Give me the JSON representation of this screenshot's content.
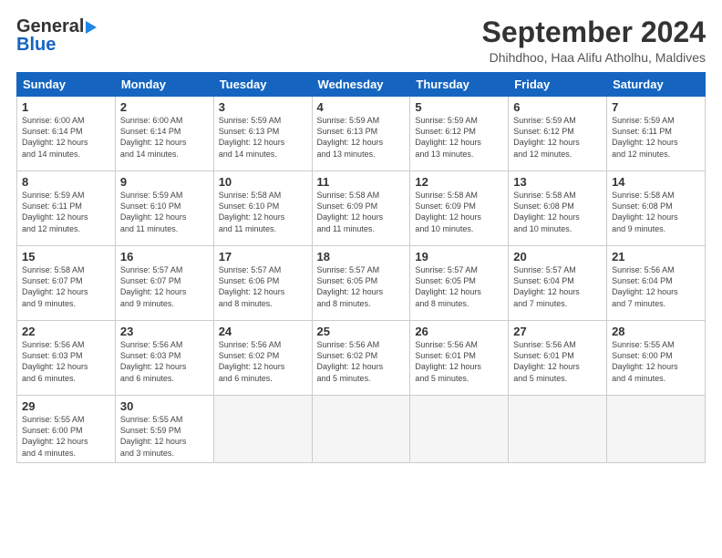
{
  "logo": {
    "general": "General",
    "blue": "Blue"
  },
  "header": {
    "month": "September 2024",
    "location": "Dhihdhoo, Haa Alifu Atholhu, Maldives"
  },
  "weekdays": [
    "Sunday",
    "Monday",
    "Tuesday",
    "Wednesday",
    "Thursday",
    "Friday",
    "Saturday"
  ],
  "weeks": [
    [
      {
        "day": "1",
        "info": "Sunrise: 6:00 AM\nSunset: 6:14 PM\nDaylight: 12 hours\nand 14 minutes."
      },
      {
        "day": "2",
        "info": "Sunrise: 6:00 AM\nSunset: 6:14 PM\nDaylight: 12 hours\nand 14 minutes."
      },
      {
        "day": "3",
        "info": "Sunrise: 5:59 AM\nSunset: 6:13 PM\nDaylight: 12 hours\nand 14 minutes."
      },
      {
        "day": "4",
        "info": "Sunrise: 5:59 AM\nSunset: 6:13 PM\nDaylight: 12 hours\nand 13 minutes."
      },
      {
        "day": "5",
        "info": "Sunrise: 5:59 AM\nSunset: 6:12 PM\nDaylight: 12 hours\nand 13 minutes."
      },
      {
        "day": "6",
        "info": "Sunrise: 5:59 AM\nSunset: 6:12 PM\nDaylight: 12 hours\nand 12 minutes."
      },
      {
        "day": "7",
        "info": "Sunrise: 5:59 AM\nSunset: 6:11 PM\nDaylight: 12 hours\nand 12 minutes."
      }
    ],
    [
      {
        "day": "8",
        "info": "Sunrise: 5:59 AM\nSunset: 6:11 PM\nDaylight: 12 hours\nand 12 minutes."
      },
      {
        "day": "9",
        "info": "Sunrise: 5:59 AM\nSunset: 6:10 PM\nDaylight: 12 hours\nand 11 minutes."
      },
      {
        "day": "10",
        "info": "Sunrise: 5:58 AM\nSunset: 6:10 PM\nDaylight: 12 hours\nand 11 minutes."
      },
      {
        "day": "11",
        "info": "Sunrise: 5:58 AM\nSunset: 6:09 PM\nDaylight: 12 hours\nand 11 minutes."
      },
      {
        "day": "12",
        "info": "Sunrise: 5:58 AM\nSunset: 6:09 PM\nDaylight: 12 hours\nand 10 minutes."
      },
      {
        "day": "13",
        "info": "Sunrise: 5:58 AM\nSunset: 6:08 PM\nDaylight: 12 hours\nand 10 minutes."
      },
      {
        "day": "14",
        "info": "Sunrise: 5:58 AM\nSunset: 6:08 PM\nDaylight: 12 hours\nand 9 minutes."
      }
    ],
    [
      {
        "day": "15",
        "info": "Sunrise: 5:58 AM\nSunset: 6:07 PM\nDaylight: 12 hours\nand 9 minutes."
      },
      {
        "day": "16",
        "info": "Sunrise: 5:57 AM\nSunset: 6:07 PM\nDaylight: 12 hours\nand 9 minutes."
      },
      {
        "day": "17",
        "info": "Sunrise: 5:57 AM\nSunset: 6:06 PM\nDaylight: 12 hours\nand 8 minutes."
      },
      {
        "day": "18",
        "info": "Sunrise: 5:57 AM\nSunset: 6:05 PM\nDaylight: 12 hours\nand 8 minutes."
      },
      {
        "day": "19",
        "info": "Sunrise: 5:57 AM\nSunset: 6:05 PM\nDaylight: 12 hours\nand 8 minutes."
      },
      {
        "day": "20",
        "info": "Sunrise: 5:57 AM\nSunset: 6:04 PM\nDaylight: 12 hours\nand 7 minutes."
      },
      {
        "day": "21",
        "info": "Sunrise: 5:56 AM\nSunset: 6:04 PM\nDaylight: 12 hours\nand 7 minutes."
      }
    ],
    [
      {
        "day": "22",
        "info": "Sunrise: 5:56 AM\nSunset: 6:03 PM\nDaylight: 12 hours\nand 6 minutes."
      },
      {
        "day": "23",
        "info": "Sunrise: 5:56 AM\nSunset: 6:03 PM\nDaylight: 12 hours\nand 6 minutes."
      },
      {
        "day": "24",
        "info": "Sunrise: 5:56 AM\nSunset: 6:02 PM\nDaylight: 12 hours\nand 6 minutes."
      },
      {
        "day": "25",
        "info": "Sunrise: 5:56 AM\nSunset: 6:02 PM\nDaylight: 12 hours\nand 5 minutes."
      },
      {
        "day": "26",
        "info": "Sunrise: 5:56 AM\nSunset: 6:01 PM\nDaylight: 12 hours\nand 5 minutes."
      },
      {
        "day": "27",
        "info": "Sunrise: 5:56 AM\nSunset: 6:01 PM\nDaylight: 12 hours\nand 5 minutes."
      },
      {
        "day": "28",
        "info": "Sunrise: 5:55 AM\nSunset: 6:00 PM\nDaylight: 12 hours\nand 4 minutes."
      }
    ],
    [
      {
        "day": "29",
        "info": "Sunrise: 5:55 AM\nSunset: 6:00 PM\nDaylight: 12 hours\nand 4 minutes."
      },
      {
        "day": "30",
        "info": "Sunrise: 5:55 AM\nSunset: 5:59 PM\nDaylight: 12 hours\nand 3 minutes."
      },
      {
        "day": "",
        "info": ""
      },
      {
        "day": "",
        "info": ""
      },
      {
        "day": "",
        "info": ""
      },
      {
        "day": "",
        "info": ""
      },
      {
        "day": "",
        "info": ""
      }
    ]
  ]
}
